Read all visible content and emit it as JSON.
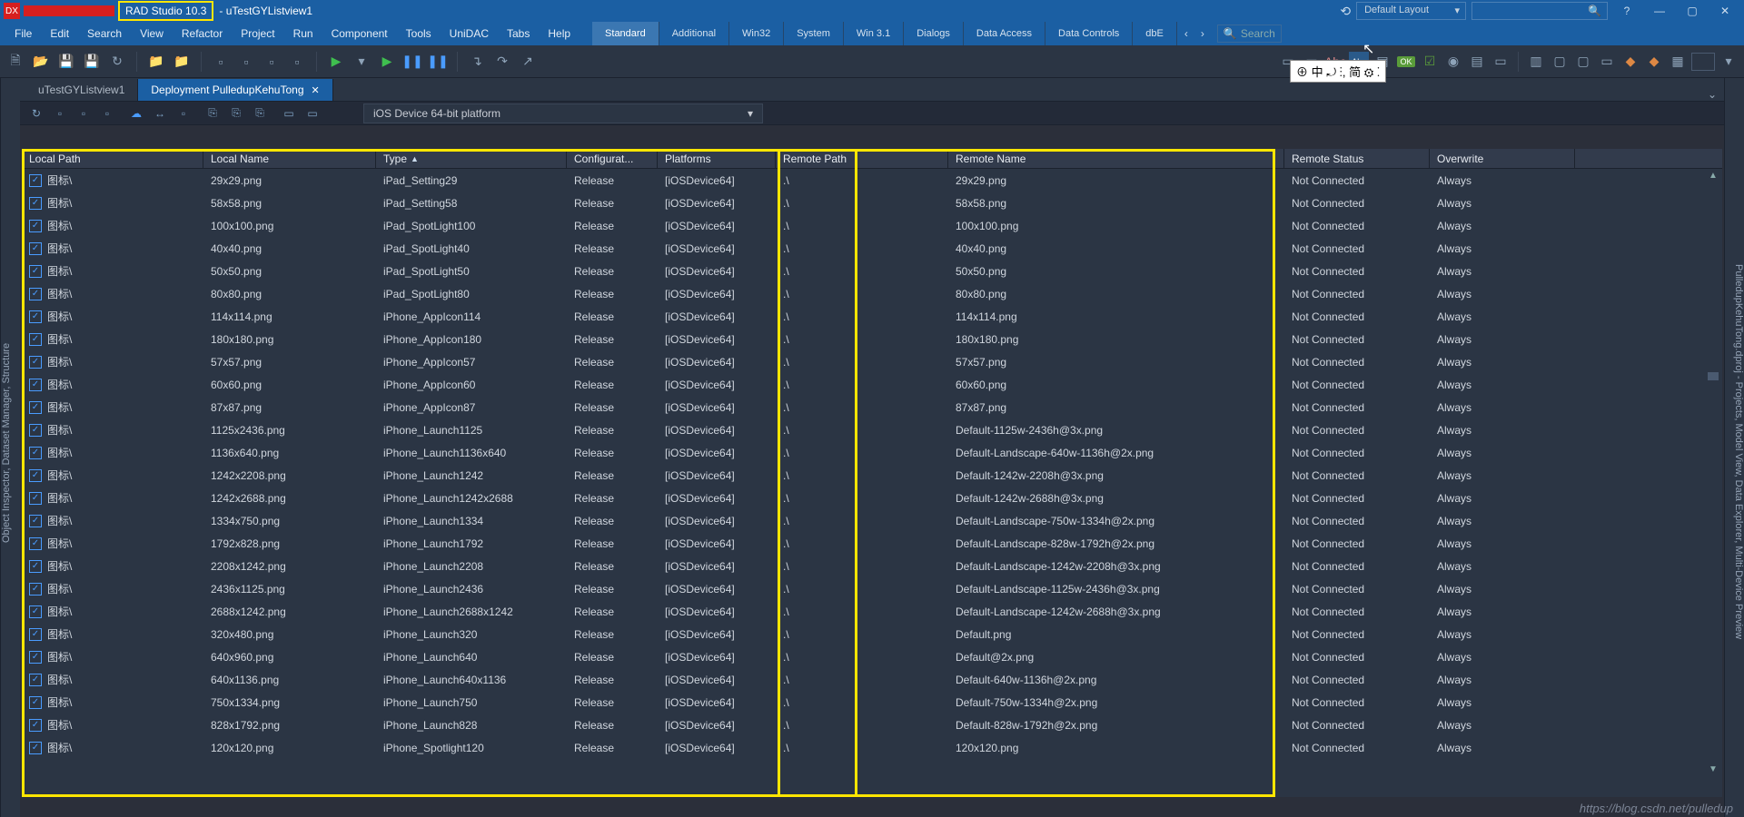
{
  "titlebar": {
    "logo": "DX",
    "version": "RAD Studio 10.3",
    "projectSuffix": "- uTestGYListview1",
    "layout": "Default Layout",
    "help_icon": "?",
    "min": "—",
    "max": "▢",
    "close": "✕"
  },
  "menu": [
    "File",
    "Edit",
    "Search",
    "View",
    "Refactor",
    "Project",
    "Run",
    "Component",
    "Tools",
    "UniDAC",
    "Tabs",
    "Help"
  ],
  "componentTabs": [
    "Standard",
    "Additional",
    "Win32",
    "System",
    "Win 3.1",
    "Dialogs",
    "Data Access",
    "Data Controls",
    "dbE"
  ],
  "searchPlaceholder": "Search",
  "editorTabs": [
    {
      "label": "uTestGYListview1",
      "active": false
    },
    {
      "label": "Deployment PulledupKehuTong",
      "active": true
    }
  ],
  "platform": "iOS Device 64-bit platform",
  "columns": [
    "Local Path",
    "Local Name",
    "Type",
    "Configurat...",
    "Platforms",
    "Remote Path",
    "Remote Name",
    "Remote Status",
    "Overwrite"
  ],
  "sortCol": 2,
  "rows": [
    {
      "lp": "图标\\",
      "ln": "29x29.png",
      "ty": "iPad_Setting29",
      "cf": "Release",
      "pl": "[iOSDevice64]",
      "rp": ".\\",
      "rn": "29x29.png",
      "rs": "Not Connected",
      "ov": "Always"
    },
    {
      "lp": "图标\\",
      "ln": "58x58.png",
      "ty": "iPad_Setting58",
      "cf": "Release",
      "pl": "[iOSDevice64]",
      "rp": ".\\",
      "rn": "58x58.png",
      "rs": "Not Connected",
      "ov": "Always"
    },
    {
      "lp": "图标\\",
      "ln": "100x100.png",
      "ty": "iPad_SpotLight100",
      "cf": "Release",
      "pl": "[iOSDevice64]",
      "rp": ".\\",
      "rn": "100x100.png",
      "rs": "Not Connected",
      "ov": "Always"
    },
    {
      "lp": "图标\\",
      "ln": "40x40.png",
      "ty": "iPad_SpotLight40",
      "cf": "Release",
      "pl": "[iOSDevice64]",
      "rp": ".\\",
      "rn": "40x40.png",
      "rs": "Not Connected",
      "ov": "Always"
    },
    {
      "lp": "图标\\",
      "ln": "50x50.png",
      "ty": "iPad_SpotLight50",
      "cf": "Release",
      "pl": "[iOSDevice64]",
      "rp": ".\\",
      "rn": "50x50.png",
      "rs": "Not Connected",
      "ov": "Always"
    },
    {
      "lp": "图标\\",
      "ln": "80x80.png",
      "ty": "iPad_SpotLight80",
      "cf": "Release",
      "pl": "[iOSDevice64]",
      "rp": ".\\",
      "rn": "80x80.png",
      "rs": "Not Connected",
      "ov": "Always"
    },
    {
      "lp": "图标\\",
      "ln": "114x114.png",
      "ty": "iPhone_AppIcon114",
      "cf": "Release",
      "pl": "[iOSDevice64]",
      "rp": ".\\",
      "rn": "114x114.png",
      "rs": "Not Connected",
      "ov": "Always"
    },
    {
      "lp": "图标\\",
      "ln": "180x180.png",
      "ty": "iPhone_AppIcon180",
      "cf": "Release",
      "pl": "[iOSDevice64]",
      "rp": ".\\",
      "rn": "180x180.png",
      "rs": "Not Connected",
      "ov": "Always"
    },
    {
      "lp": "图标\\",
      "ln": "57x57.png",
      "ty": "iPhone_AppIcon57",
      "cf": "Release",
      "pl": "[iOSDevice64]",
      "rp": ".\\",
      "rn": "57x57.png",
      "rs": "Not Connected",
      "ov": "Always"
    },
    {
      "lp": "图标\\",
      "ln": "60x60.png",
      "ty": "iPhone_AppIcon60",
      "cf": "Release",
      "pl": "[iOSDevice64]",
      "rp": ".\\",
      "rn": "60x60.png",
      "rs": "Not Connected",
      "ov": "Always"
    },
    {
      "lp": "图标\\",
      "ln": "87x87.png",
      "ty": "iPhone_AppIcon87",
      "cf": "Release",
      "pl": "[iOSDevice64]",
      "rp": ".\\",
      "rn": "87x87.png",
      "rs": "Not Connected",
      "ov": "Always"
    },
    {
      "lp": "图标\\",
      "ln": "1125x2436.png",
      "ty": "iPhone_Launch1125",
      "cf": "Release",
      "pl": "[iOSDevice64]",
      "rp": ".\\",
      "rn": "Default-1125w-2436h@3x.png",
      "rs": "Not Connected",
      "ov": "Always"
    },
    {
      "lp": "图标\\",
      "ln": "1136x640.png",
      "ty": "iPhone_Launch1136x640",
      "cf": "Release",
      "pl": "[iOSDevice64]",
      "rp": ".\\",
      "rn": "Default-Landscape-640w-1136h@2x.png",
      "rs": "Not Connected",
      "ov": "Always"
    },
    {
      "lp": "图标\\",
      "ln": "1242x2208.png",
      "ty": "iPhone_Launch1242",
      "cf": "Release",
      "pl": "[iOSDevice64]",
      "rp": ".\\",
      "rn": "Default-1242w-2208h@3x.png",
      "rs": "Not Connected",
      "ov": "Always"
    },
    {
      "lp": "图标\\",
      "ln": "1242x2688.png",
      "ty": "iPhone_Launch1242x2688",
      "cf": "Release",
      "pl": "[iOSDevice64]",
      "rp": ".\\",
      "rn": "Default-1242w-2688h@3x.png",
      "rs": "Not Connected",
      "ov": "Always"
    },
    {
      "lp": "图标\\",
      "ln": "1334x750.png",
      "ty": "iPhone_Launch1334",
      "cf": "Release",
      "pl": "[iOSDevice64]",
      "rp": ".\\",
      "rn": "Default-Landscape-750w-1334h@2x.png",
      "rs": "Not Connected",
      "ov": "Always"
    },
    {
      "lp": "图标\\",
      "ln": "1792x828.png",
      "ty": "iPhone_Launch1792",
      "cf": "Release",
      "pl": "[iOSDevice64]",
      "rp": ".\\",
      "rn": "Default-Landscape-828w-1792h@2x.png",
      "rs": "Not Connected",
      "ov": "Always"
    },
    {
      "lp": "图标\\",
      "ln": "2208x1242.png",
      "ty": "iPhone_Launch2208",
      "cf": "Release",
      "pl": "[iOSDevice64]",
      "rp": ".\\",
      "rn": "Default-Landscape-1242w-2208h@3x.png",
      "rs": "Not Connected",
      "ov": "Always"
    },
    {
      "lp": "图标\\",
      "ln": "2436x1125.png",
      "ty": "iPhone_Launch2436",
      "cf": "Release",
      "pl": "[iOSDevice64]",
      "rp": ".\\",
      "rn": "Default-Landscape-1125w-2436h@3x.png",
      "rs": "Not Connected",
      "ov": "Always"
    },
    {
      "lp": "图标\\",
      "ln": "2688x1242.png",
      "ty": "iPhone_Launch2688x1242",
      "cf": "Release",
      "pl": "[iOSDevice64]",
      "rp": ".\\",
      "rn": "Default-Landscape-1242w-2688h@3x.png",
      "rs": "Not Connected",
      "ov": "Always"
    },
    {
      "lp": "图标\\",
      "ln": "320x480.png",
      "ty": "iPhone_Launch320",
      "cf": "Release",
      "pl": "[iOSDevice64]",
      "rp": ".\\",
      "rn": "Default.png",
      "rs": "Not Connected",
      "ov": "Always"
    },
    {
      "lp": "图标\\",
      "ln": "640x960.png",
      "ty": "iPhone_Launch640",
      "cf": "Release",
      "pl": "[iOSDevice64]",
      "rp": ".\\",
      "rn": "Default@2x.png",
      "rs": "Not Connected",
      "ov": "Always"
    },
    {
      "lp": "图标\\",
      "ln": "640x1136.png",
      "ty": "iPhone_Launch640x1136",
      "cf": "Release",
      "pl": "[iOSDevice64]",
      "rp": ".\\",
      "rn": "Default-640w-1136h@2x.png",
      "rs": "Not Connected",
      "ov": "Always"
    },
    {
      "lp": "图标\\",
      "ln": "750x1334.png",
      "ty": "iPhone_Launch750",
      "cf": "Release",
      "pl": "[iOSDevice64]",
      "rp": ".\\",
      "rn": "Default-750w-1334h@2x.png",
      "rs": "Not Connected",
      "ov": "Always"
    },
    {
      "lp": "图标\\",
      "ln": "828x1792.png",
      "ty": "iPhone_Launch828",
      "cf": "Release",
      "pl": "[iOSDevice64]",
      "rp": ".\\",
      "rn": "Default-828w-1792h@2x.png",
      "rs": "Not Connected",
      "ov": "Always"
    },
    {
      "lp": "图标\\",
      "ln": "120x120.png",
      "ty": "iPhone_Spotlight120",
      "cf": "Release",
      "pl": "[iOSDevice64]",
      "rp": ".\\",
      "rn": "120x120.png",
      "rs": "Not Connected",
      "ov": "Always"
    }
  ],
  "leftRail": "Object Inspector, Dataset Manager, Structure",
  "rightRail": "PulledupKehuTong.dproj - Projects, Model View, Data Explorer, Multi-Device Preview",
  "watermark": "https://blog.csdn.net/pulledup",
  "ime": "⊕ 中 ⤾ ⁝, 简 ⚙ ⁚"
}
